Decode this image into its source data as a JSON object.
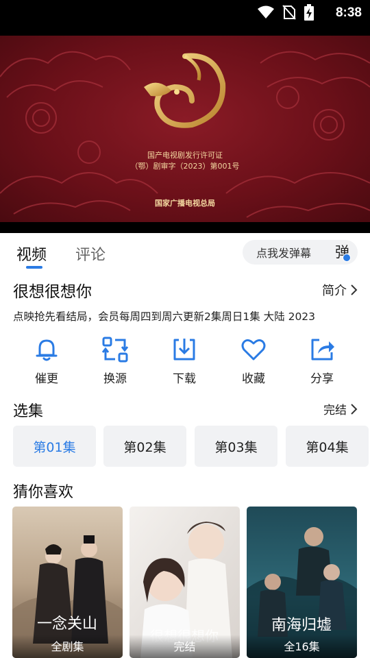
{
  "status": {
    "time": "8:38"
  },
  "player": {
    "license_line1": "国产电视剧发行许可证",
    "license_line2": "（鄂）剧审字（2023）第001号",
    "license_org": "国家广播电视总局"
  },
  "tabs": {
    "video": "视频",
    "comments": "评论"
  },
  "danmu": {
    "placeholder": "点我发弹幕",
    "icon_label": "弹"
  },
  "show": {
    "title": "很想很想你",
    "intro_link": "简介",
    "meta": "点映抢先看结局，会员每周四到周六更新2集周日1集 大陆 2023"
  },
  "actions": [
    {
      "label": "催更",
      "icon": "bell-icon"
    },
    {
      "label": "换源",
      "icon": "switch-source-icon"
    },
    {
      "label": "下载",
      "icon": "download-icon"
    },
    {
      "label": "收藏",
      "icon": "heart-icon"
    },
    {
      "label": "分享",
      "icon": "share-icon"
    }
  ],
  "episodes": {
    "title": "选集",
    "status": "完结",
    "items": [
      "第01集",
      "第02集",
      "第03集",
      "第04集"
    ],
    "selected": 0
  },
  "recommend": {
    "title": "猜你喜欢",
    "items": [
      {
        "caption": "全剧集"
      },
      {
        "caption": "完结"
      },
      {
        "caption": "全16集"
      }
    ]
  },
  "colors": {
    "accent": "#2a7be4",
    "player_red": "#6b1019",
    "gold": "#d9a84a"
  }
}
